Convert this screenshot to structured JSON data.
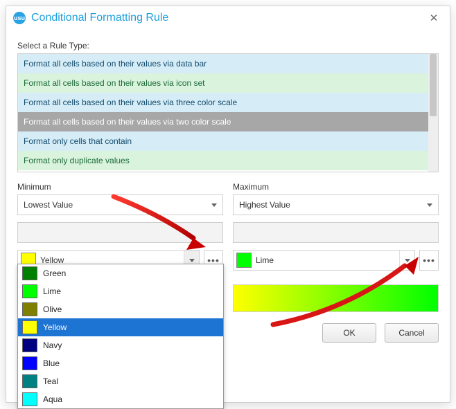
{
  "dialog": {
    "title": "Conditional Formatting Rule",
    "app_icon_text": "usu",
    "close_glyph": "✕"
  },
  "rule_type": {
    "label": "Select a Rule Type:",
    "items": [
      "Format all cells based on their values via data bar",
      "Format all cells based on their values via icon set",
      "Format all cells based on their values via three color scale",
      "Format all cells based on their values via two color scale",
      "Format only cells that contain",
      "Format only duplicate values"
    ],
    "selected_index": 3
  },
  "minimum": {
    "label": "Minimum",
    "value_mode": "Lowest Value",
    "color_name": "Yellow",
    "color_hex": "#ffff00",
    "more_glyph": "•••"
  },
  "maximum": {
    "label": "Maximum",
    "value_mode": "Highest Value",
    "color_name": "Lime",
    "color_hex": "#00ff00",
    "more_glyph": "•••"
  },
  "buttons": {
    "ok": "OK",
    "cancel": "Cancel"
  },
  "color_dropdown": {
    "selected_index": 3,
    "options": [
      {
        "name": "Green",
        "hex": "#008000"
      },
      {
        "name": "Lime",
        "hex": "#00ff00"
      },
      {
        "name": "Olive",
        "hex": "#808000"
      },
      {
        "name": "Yellow",
        "hex": "#ffff00"
      },
      {
        "name": "Navy",
        "hex": "#000080"
      },
      {
        "name": "Blue",
        "hex": "#0000ff"
      },
      {
        "name": "Teal",
        "hex": "#008080"
      },
      {
        "name": "Aqua",
        "hex": "#00ffff"
      }
    ]
  },
  "preview": {
    "from": "#ffff00",
    "to": "#00ff00"
  }
}
